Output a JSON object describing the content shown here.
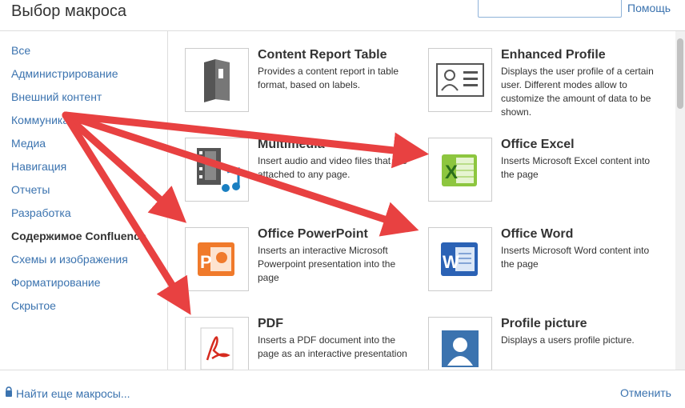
{
  "header": {
    "title": "Выбор макроса",
    "search_value": "",
    "search_button": "Помощь"
  },
  "sidebar": {
    "categories": [
      {
        "label": "Все"
      },
      {
        "label": "Администрирование"
      },
      {
        "label": "Внешний контент"
      },
      {
        "label": "Коммуникация"
      },
      {
        "label": "Медиа"
      },
      {
        "label": "Навигация"
      },
      {
        "label": "Отчеты"
      },
      {
        "label": "Разработка"
      },
      {
        "label": "Содержимое Confluence",
        "active": true
      },
      {
        "label": "Схемы и изображения"
      },
      {
        "label": "Форматирование"
      },
      {
        "label": "Скрытое"
      }
    ]
  },
  "macros": [
    {
      "name": "Content Report Table",
      "desc": "Provides a content report in table format, based on labels.",
      "icon": "report-icon"
    },
    {
      "name": "Enhanced Profile",
      "desc": "Displays the user profile of a certain user. Different modes allow to customize the amount of data to be shown.",
      "icon": "profile-card-icon"
    },
    {
      "name": "Multimedia",
      "desc": "Insert audio and video files that are attached to any page.",
      "icon": "multimedia-icon"
    },
    {
      "name": "Office Excel",
      "desc": "Inserts Microsoft Excel content into the page",
      "icon": "excel-icon"
    },
    {
      "name": "Office PowerPoint",
      "desc": "Inserts an interactive Microsoft Powerpoint presentation into the page",
      "icon": "powerpoint-icon"
    },
    {
      "name": "Office Word",
      "desc": "Inserts Microsoft Word content into the page",
      "icon": "word-icon"
    },
    {
      "name": "PDF",
      "desc": "Inserts a PDF document into the page as an interactive presentation",
      "icon": "pdf-icon"
    },
    {
      "name": "Profile picture",
      "desc": "Displays a users profile picture.",
      "icon": "profile-picture-icon"
    }
  ],
  "footer": {
    "find_more": "Найти еще макросы...",
    "cancel": "Отменить"
  },
  "colors": {
    "link": "#3b73af",
    "annotation_arrow": "#e84141"
  }
}
